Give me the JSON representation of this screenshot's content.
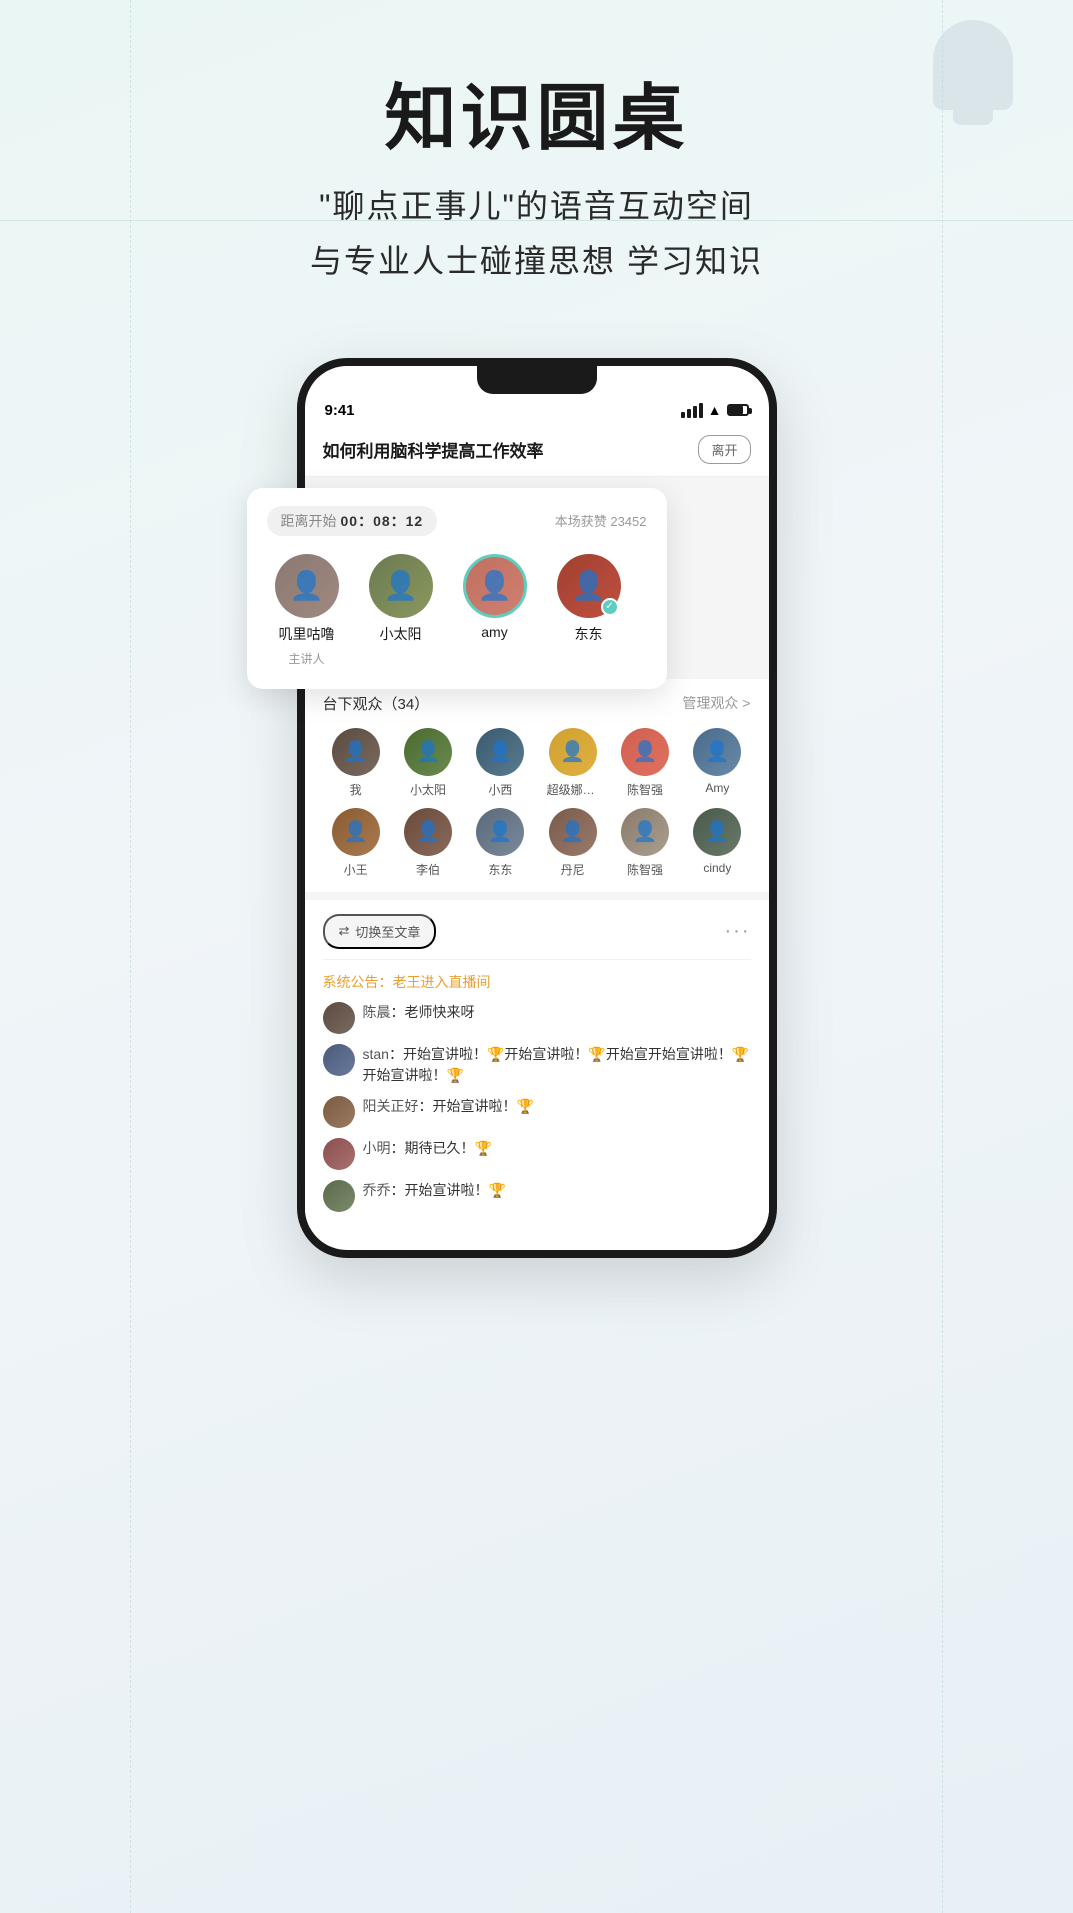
{
  "page": {
    "background": "#eaf6f4"
  },
  "hero": {
    "title_line1": "知识圆桌",
    "subtitle_line1": "\"聊点正事儿\"的语音互动空间",
    "subtitle_line2": "与专业人士碰撞思想 学习知识"
  },
  "phone": {
    "status_bar": {
      "time": "9:41",
      "signal": "▌▌▌",
      "wifi": "WiFi",
      "battery": "Battery"
    },
    "room": {
      "title": "如何利用脑科学提高工作效率",
      "leave_btn": "离开"
    },
    "countdown_card": {
      "label": "距离开始",
      "time": "00：08：12",
      "likes_label": "本场获赞",
      "likes_count": "23452"
    },
    "speakers": [
      {
        "name": "叽里咕噜",
        "role": "主讲人",
        "active": false
      },
      {
        "name": "小太阳",
        "role": "",
        "active": false
      },
      {
        "name": "amy",
        "role": "",
        "active": true
      },
      {
        "name": "东东",
        "role": "",
        "active": false,
        "badge": "✓"
      }
    ],
    "audience": {
      "title": "台下观众（34）",
      "manage_label": "管理观众 >",
      "members": [
        {
          "name": "我"
        },
        {
          "name": "小太阳"
        },
        {
          "name": "小西"
        },
        {
          "name": "超级娜丽..."
        },
        {
          "name": "陈智强"
        },
        {
          "name": "Amy"
        },
        {
          "name": "小王"
        },
        {
          "name": "李伯"
        },
        {
          "name": "东东"
        },
        {
          "name": "丹尼"
        },
        {
          "name": "陈智强"
        },
        {
          "name": "cindy"
        }
      ]
    },
    "chat": {
      "switch_label": "切换至文章",
      "more": "···",
      "messages": [
        {
          "type": "system",
          "text_prefix": "系统公告：",
          "text_highlight": "老王进入直播间",
          "text_suffix": ""
        },
        {
          "type": "user",
          "name": "陈晨",
          "text": "老师快来呀"
        },
        {
          "type": "user",
          "name": "stan",
          "text": "开始宣讲啦！🏆开始宣讲啦！🏆开始宣开始宣讲啦！🏆开始宣讲啦！🏆"
        },
        {
          "type": "user",
          "name": "阳关正好",
          "text": "开始宣讲啦！🏆"
        },
        {
          "type": "user",
          "name": "小明",
          "text": "期待已久！🏆"
        },
        {
          "type": "user",
          "name": "乔乔",
          "text": "开始宣讲啦！🏆"
        }
      ]
    }
  }
}
